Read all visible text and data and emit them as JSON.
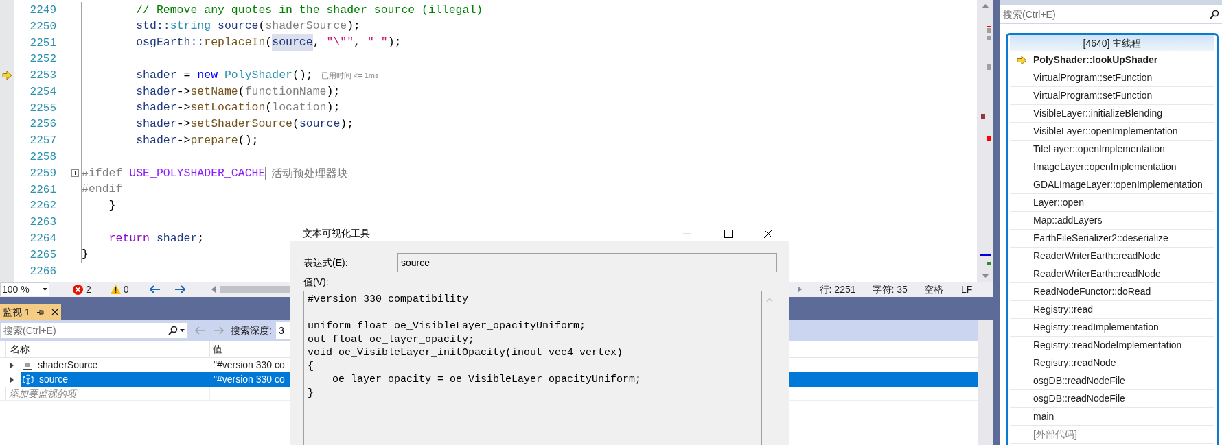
{
  "editor": {
    "lines": [
      {
        "number": "2249",
        "current": false,
        "tokens": [
          {
            "kind": "comment",
            "text": "        // Remove any quotes in the shader source (illegal)"
          }
        ]
      },
      {
        "number": "2250",
        "current": false,
        "tokens": [
          {
            "kind": "local",
            "text": "        std::"
          },
          {
            "kind": "type",
            "text": "string "
          },
          {
            "kind": "local",
            "text": "source"
          },
          {
            "kind": "plain",
            "text": "("
          },
          {
            "kind": "param",
            "text": "shaderSource"
          },
          {
            "kind": "plain",
            "text": ");"
          }
        ]
      },
      {
        "number": "2251",
        "current": false,
        "tokens": [
          {
            "kind": "local",
            "text": "        osgEarth::"
          },
          {
            "kind": "func",
            "text": "replaceIn"
          },
          {
            "kind": "plain",
            "text": "("
          },
          {
            "kind": "reference",
            "text": "source"
          },
          {
            "kind": "plain",
            "text": ", "
          },
          {
            "kind": "string",
            "text": "\"\\\"\""
          },
          {
            "kind": "plain",
            "text": ", "
          },
          {
            "kind": "string",
            "text": "\" \""
          },
          {
            "kind": "plain",
            "text": ");"
          }
        ]
      },
      {
        "number": "2252",
        "current": false
      },
      {
        "number": "2253",
        "current": true,
        "hint": "已用时间 <= 1ms",
        "tokens": [
          {
            "kind": "local",
            "text": "        shader"
          },
          {
            "kind": "plain",
            "text": " = "
          },
          {
            "kind": "keyword",
            "text": "new "
          },
          {
            "kind": "type",
            "text": "PolyShader"
          },
          {
            "kind": "plain",
            "text": "();"
          }
        ]
      },
      {
        "number": "2254",
        "current": false,
        "tokens": [
          {
            "kind": "local",
            "text": "        shader"
          },
          {
            "kind": "plain",
            "text": "->"
          },
          {
            "kind": "func",
            "text": "setName"
          },
          {
            "kind": "plain",
            "text": "("
          },
          {
            "kind": "param",
            "text": "functionName"
          },
          {
            "kind": "plain",
            "text": ");"
          }
        ]
      },
      {
        "number": "2255",
        "current": false,
        "tokens": [
          {
            "kind": "local",
            "text": "        shader"
          },
          {
            "kind": "plain",
            "text": "->"
          },
          {
            "kind": "func",
            "text": "setLocation"
          },
          {
            "kind": "plain",
            "text": "("
          },
          {
            "kind": "param",
            "text": "location"
          },
          {
            "kind": "plain",
            "text": ");"
          }
        ]
      },
      {
        "number": "2256",
        "current": false,
        "tokens": [
          {
            "kind": "local",
            "text": "        shader"
          },
          {
            "kind": "plain",
            "text": "->"
          },
          {
            "kind": "func",
            "text": "setShaderSource"
          },
          {
            "kind": "plain",
            "text": "("
          },
          {
            "kind": "local",
            "text": "source"
          },
          {
            "kind": "plain",
            "text": ");"
          }
        ]
      },
      {
        "number": "2257",
        "current": false,
        "tokens": [
          {
            "kind": "local",
            "text": "        shader"
          },
          {
            "kind": "plain",
            "text": "->"
          },
          {
            "kind": "func",
            "text": "prepare"
          },
          {
            "kind": "plain",
            "text": "();"
          }
        ]
      },
      {
        "number": "2258",
        "current": false
      },
      {
        "number": "2259",
        "current": false,
        "collapsed": true,
        "fold_tag": "活动预处理器块",
        "tokens": [
          {
            "kind": "preproc",
            "text": "#ifdef "
          },
          {
            "kind": "macro",
            "text": "USE_POLYSHADER_CACHE"
          }
        ]
      },
      {
        "number": "2261",
        "current": false,
        "tokens": [
          {
            "kind": "preproc",
            "text": "#endif"
          }
        ]
      },
      {
        "number": "2262",
        "current": false,
        "tokens": [
          {
            "kind": "plain",
            "text": "    }"
          }
        ]
      },
      {
        "number": "2263",
        "current": false
      },
      {
        "number": "2264",
        "current": false,
        "tokens": [
          {
            "kind": "control",
            "text": "    return "
          },
          {
            "kind": "local",
            "text": "shader"
          },
          {
            "kind": "plain",
            "text": ";"
          }
        ]
      },
      {
        "number": "2265",
        "current": false,
        "tokens": [
          {
            "kind": "plain",
            "text": "}"
          }
        ]
      },
      {
        "number": "2266",
        "current": false
      }
    ]
  },
  "status_bar": {
    "zoom": "100 %",
    "errors": "2",
    "warnings": "0",
    "line": "行: 2251",
    "char": "字符: 35",
    "indent": "空格",
    "eol": "LF"
  },
  "watch": {
    "tab": "监视 1",
    "search": {
      "placeholder": "搜索(Ctrl+E)"
    },
    "depth_label": "搜索深度:",
    "depth_value": "3",
    "columns": [
      "名称",
      "值"
    ],
    "rows": [
      {
        "name": "shaderSource",
        "value": "\"#version 330 co",
        "kind": "field",
        "selected": false
      },
      {
        "name": "source",
        "value": "\"#version 330 co",
        "kind": "local",
        "selected": true
      }
    ],
    "add_placeholder": "添加要监视的项"
  },
  "dialog": {
    "title": "文本可视化工具",
    "expression_label": "表达式(E):",
    "expression": "source",
    "value_label": "值(V):",
    "value": "#version 330 compatibility\n\nuniform float oe_VisibleLayer_opacityUniform;\nout float oe_layer_opacity;\nvoid oe_VisibleLayer_initOpacity(inout vec4 vertex)\n{\n    oe_layer_opacity = oe_VisibleLayer_opacityUniform;\n}"
  },
  "right_panel": {
    "search": {
      "placeholder": "搜索(Ctrl+E)"
    },
    "call_stack": {
      "title": "[4640] 主线程",
      "frames": [
        {
          "name": "PolyShader::lookUpShader",
          "kind": "current"
        },
        {
          "name": "VirtualProgram::setFunction",
          "kind": "frame"
        },
        {
          "name": "VirtualProgram::setFunction",
          "kind": "frame"
        },
        {
          "name": "VisibleLayer::initializeBlending",
          "kind": "frame"
        },
        {
          "name": "VisibleLayer::openImplementation",
          "kind": "frame"
        },
        {
          "name": "TileLayer::openImplementation",
          "kind": "frame"
        },
        {
          "name": "ImageLayer::openImplementation",
          "kind": "frame"
        },
        {
          "name": "GDALImageLayer::openImplementation",
          "kind": "frame"
        },
        {
          "name": "Layer::open",
          "kind": "frame"
        },
        {
          "name": "Map::addLayers",
          "kind": "frame"
        },
        {
          "name": "EarthFileSerializer2::deserialize",
          "kind": "frame"
        },
        {
          "name": "ReaderWriterEarth::readNode",
          "kind": "frame"
        },
        {
          "name": "ReaderWriterEarth::readNode",
          "kind": "frame"
        },
        {
          "name": "ReadNodeFunctor::doRead",
          "kind": "frame"
        },
        {
          "name": "Registry::read",
          "kind": "frame"
        },
        {
          "name": "Registry::readImplementation",
          "kind": "frame"
        },
        {
          "name": "Registry::readNodeImplementation",
          "kind": "frame"
        },
        {
          "name": "Registry::readNode",
          "kind": "frame"
        },
        {
          "name": "osgDB::readNodeFile",
          "kind": "frame"
        },
        {
          "name": "osgDB::readNodeFile",
          "kind": "frame"
        },
        {
          "name": "main",
          "kind": "frame"
        },
        {
          "name": "[外部代码]",
          "kind": "external"
        }
      ]
    }
  }
}
